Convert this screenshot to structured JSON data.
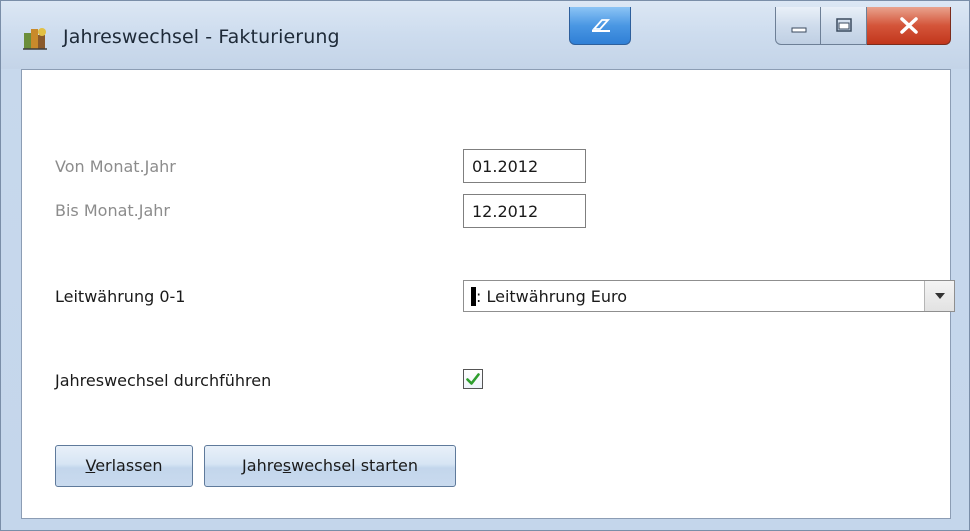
{
  "window": {
    "title": "Jahreswechsel - Fakturierung"
  },
  "icons": {
    "app": "app-icon",
    "pin": "pin-icon",
    "minimize": "minimize-icon",
    "maximize": "maximize-icon",
    "close": "close-icon",
    "dropdown": "chevron-down-icon",
    "check": "check-icon"
  },
  "form": {
    "von": {
      "label": "Von Monat.Jahr",
      "value": "01.2012"
    },
    "bis": {
      "label": "Bis Monat.Jahr",
      "value": "12.2012"
    },
    "leitwaehrung": {
      "label": "Leitwährung 0-1",
      "selected": ": Leitwährung Euro"
    },
    "durchfuehren": {
      "label": "Jahreswechsel durchführen",
      "checked": true
    }
  },
  "buttons": {
    "verlassen": {
      "mnemonic": "V",
      "rest": "erlassen"
    },
    "starten": {
      "pre": "Jahre",
      "mnemonic": "s",
      "post": "wechsel starten"
    }
  },
  "colors": {
    "check": "#2e9e2e",
    "label_dim": "#8c8c8c",
    "close_button": "#c2361c"
  }
}
